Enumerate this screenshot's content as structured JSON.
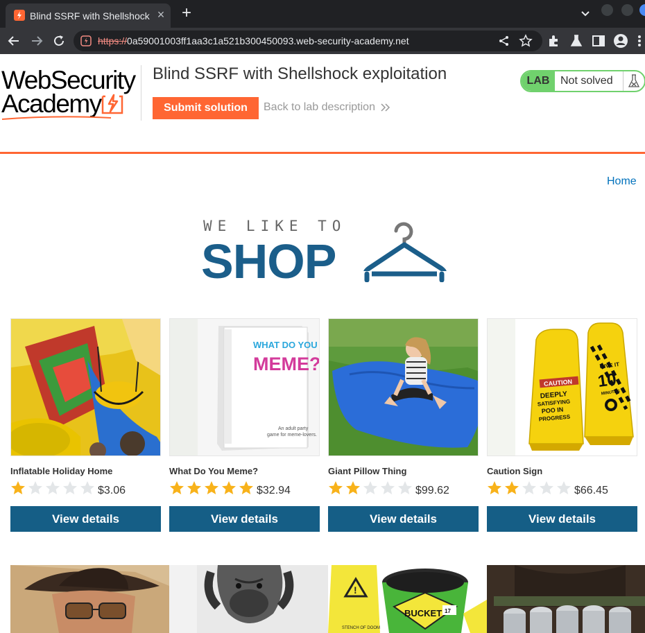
{
  "browser": {
    "tab_title": "Blind SSRF with Shellshock exploitation",
    "tab_close": "×",
    "new_tab": "+",
    "url_scheme": "https://",
    "url_host": "0a59001003ff1aa3c1a521b300450093.web-security-academy.net"
  },
  "academy": {
    "logo_line1": "WebSecurity",
    "logo_line2": "Academy",
    "lab_title": "Blind SSRF with Shellshock exploitation",
    "submit_label": "Submit solution",
    "back_label": "Back to lab description",
    "lab_badge": "LAB",
    "lab_status": "Not solved",
    "accent_color": "#ff6633",
    "status_color": "#70d16d"
  },
  "shop": {
    "home_link": "Home",
    "tagline": "WE LIKE TO",
    "title": "SHOP",
    "button_color": "#155e86"
  },
  "products": [
    {
      "name": "Inflatable Holiday Home",
      "rating": 1,
      "max_rating": 5,
      "price": "$3.06",
      "button": "View details"
    },
    {
      "name": "What Do You Meme?",
      "rating": 5,
      "max_rating": 5,
      "price": "$32.94",
      "button": "View details",
      "box_text_1": "WHAT DO YOU",
      "box_text_2": "MEME?",
      "box_sub_1": "An adult party",
      "box_sub_2": "game for meme-lovers."
    },
    {
      "name": "Giant Pillow Thing",
      "rating": 2,
      "max_rating": 5,
      "price": "$99.62",
      "button": "View details"
    },
    {
      "name": "Caution Sign",
      "rating": 2,
      "max_rating": 5,
      "price": "$66.45",
      "button": "View details",
      "sign_text_1": "CAUTION",
      "sign_text_2": "DEEPLY",
      "sign_text_3": "SATISFYING",
      "sign_text_4": "POO IN",
      "sign_text_5": "PROGRESS",
      "sign_text_6": "GIVE IT",
      "sign_text_7": "10",
      "sign_text_8": "MINUTES"
    }
  ],
  "products_row2": [
    {
      "image": "man-in-hat"
    },
    {
      "image": "dog"
    },
    {
      "image": "bucket",
      "label_1": "BUCKET",
      "label_2": "STENCH OF DOOM",
      "label_3": "17"
    },
    {
      "image": "beer-cans"
    }
  ]
}
